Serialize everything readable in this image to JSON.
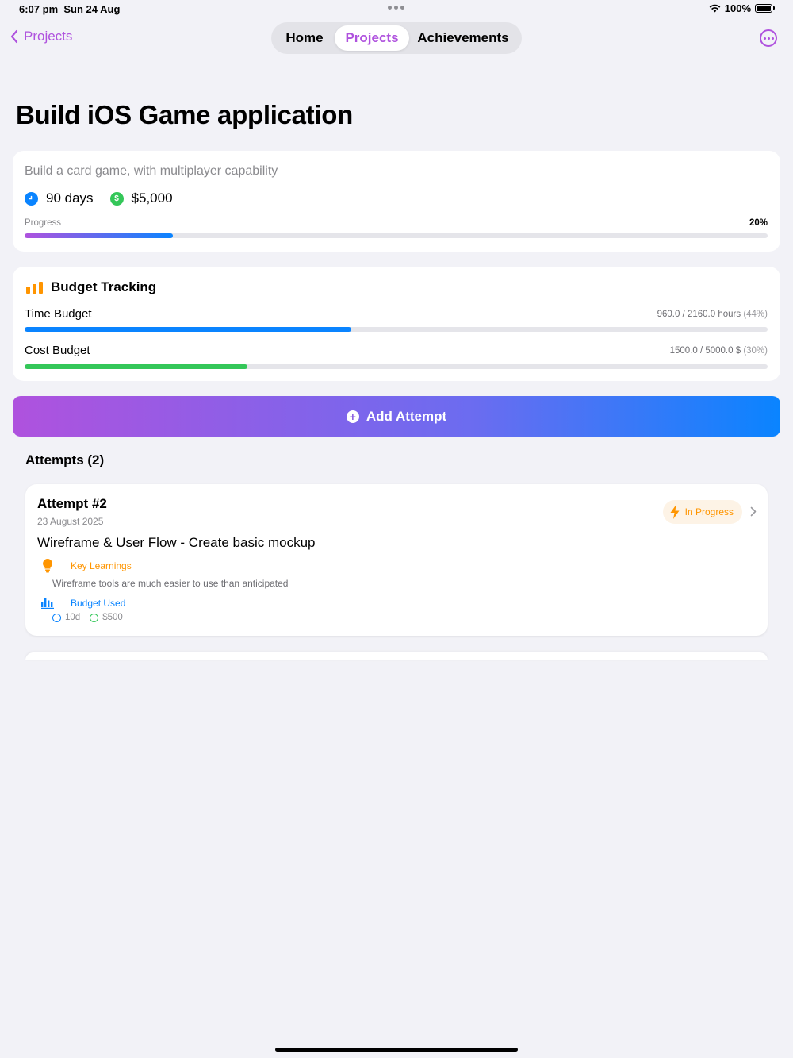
{
  "status": {
    "time": "6:07 pm",
    "date": "Sun 24 Aug",
    "battery": "100%"
  },
  "nav": {
    "back_label": "Projects",
    "tabs": [
      {
        "label": "Home",
        "selected": false
      },
      {
        "label": "Projects",
        "selected": true
      },
      {
        "label": "Achievements",
        "selected": false
      }
    ],
    "accent": "#af52de"
  },
  "project": {
    "title": "Build iOS Game application",
    "description": "Build a card game, with multiplayer capability",
    "duration": "90 days",
    "budget": "$5,000",
    "progress_label": "Progress",
    "progress_text": "20%",
    "progress": 0.2
  },
  "budget_tracking": {
    "title": "Budget Tracking",
    "time": {
      "label": "Time Budget",
      "value": "960.0 / 2160.0 hours",
      "pct_text": "(44%)",
      "fraction": 0.44,
      "color": "#0a84ff"
    },
    "cost": {
      "label": "Cost Budget",
      "value": "1500.0 / 5000.0 $",
      "pct_text": "(30%)",
      "fraction": 0.3,
      "color": "#34c759"
    }
  },
  "add_attempt_label": "Add Attempt",
  "attempts_header": "Attempts (2)",
  "attempts": [
    {
      "name": "Attempt #2",
      "date": "23 August 2025",
      "description": "Wireframe & User Flow - Create basic mockup",
      "status": "In Progress",
      "key_learnings_label": "Key Learnings",
      "key_learnings": "Wireframe tools are much easier to use than anticipated",
      "budget_used_label": "Budget Used",
      "days_used": "10d",
      "cost_used": "$500"
    }
  ]
}
